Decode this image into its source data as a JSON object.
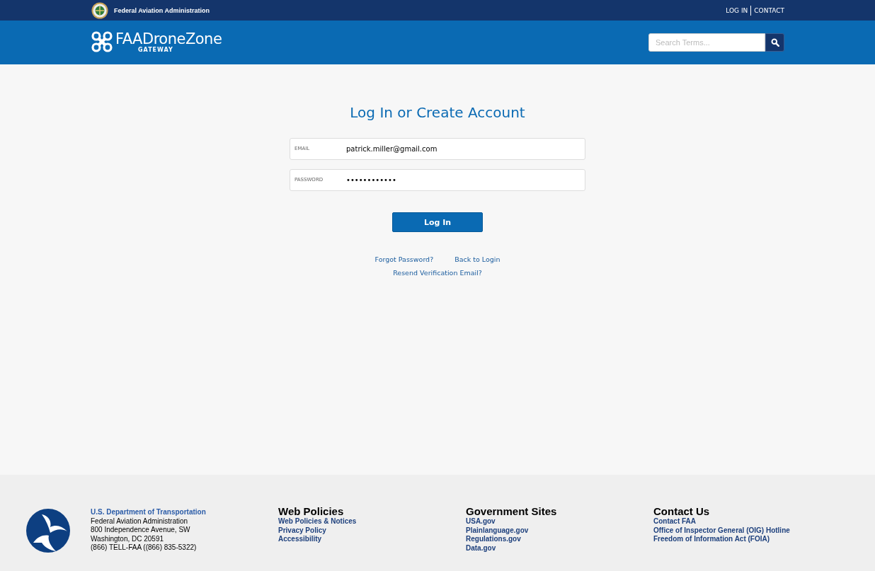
{
  "top_bar": {
    "agency": "Federal Aviation Administration",
    "links": [
      "LOG IN",
      "CONTACT"
    ]
  },
  "header": {
    "brand": "FAADroneZone",
    "brand_sub": "GATEWAY",
    "search": {
      "placeholder": "Search Terms..."
    }
  },
  "login": {
    "title": "Log In or Create Account",
    "fields": [
      {
        "label": "EMAIL",
        "value": "patrick.miller@gmail.com"
      },
      {
        "label": "PASSWORD",
        "value": "••••••••••••"
      }
    ],
    "button": "Log In",
    "links": [
      "Forgot Password?",
      "Back to Login"
    ],
    "resend_link": "Resend Verification Email?"
  },
  "footer": {
    "dot": {
      "title": "U.S. Department of Transportation",
      "lines": [
        "Federal Aviation Administration",
        "800 Independence Avenue, SW",
        "Washington, DC 20591",
        "(866) TELL-FAA ((866) 835-5322)"
      ]
    },
    "columns": [
      {
        "heading": "Web Policies",
        "links": [
          "Web Policies & Notices",
          "Privacy Policy",
          "Accessibility"
        ]
      },
      {
        "heading": "Government Sites",
        "links": [
          "USA.gov",
          "Plainlanguage.gov",
          "Regulations.gov",
          "Data.gov"
        ]
      },
      {
        "heading": "Contact Us",
        "links": [
          "Contact FAA",
          "Office of Inspector General (OIG) Hotline",
          "Freedom of Information Act (FOIA)"
        ]
      }
    ]
  }
}
